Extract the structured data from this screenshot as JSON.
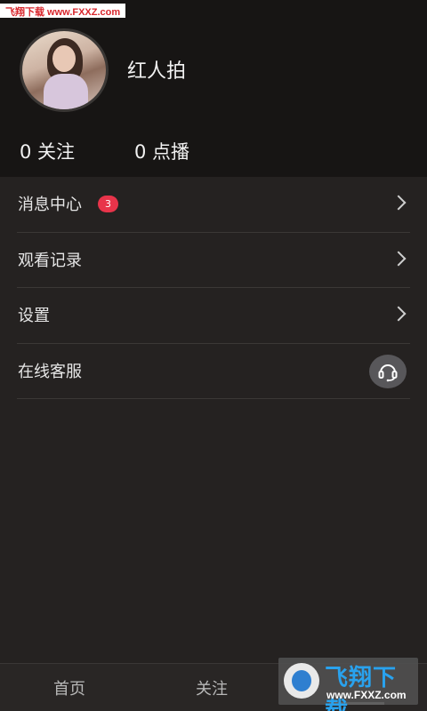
{
  "watermark": {
    "top_text": "飞翔下载 www.FXXZ.com",
    "logo_title": "飞翔下载",
    "logo_url": "www.FXXZ.com"
  },
  "profile": {
    "username": "红人拍",
    "stats": {
      "follow": "0 关注",
      "play": "0 点播"
    }
  },
  "menu": {
    "items": [
      {
        "label": "消息中心",
        "badge": "3",
        "trailing_icon": "chevron-right-icon"
      },
      {
        "label": "观看记录",
        "trailing_icon": "chevron-right-icon"
      },
      {
        "label": "设置",
        "trailing_icon": "chevron-right-icon"
      },
      {
        "label": "在线客服",
        "trailing_icon": "headset-icon"
      }
    ]
  },
  "tabbar": {
    "tabs": [
      {
        "label": "首页"
      },
      {
        "label": "关注"
      }
    ],
    "active_color": "#f2f2f2"
  },
  "colors": {
    "background": "#252221",
    "header": "#171514",
    "badge": "#e8344a"
  }
}
